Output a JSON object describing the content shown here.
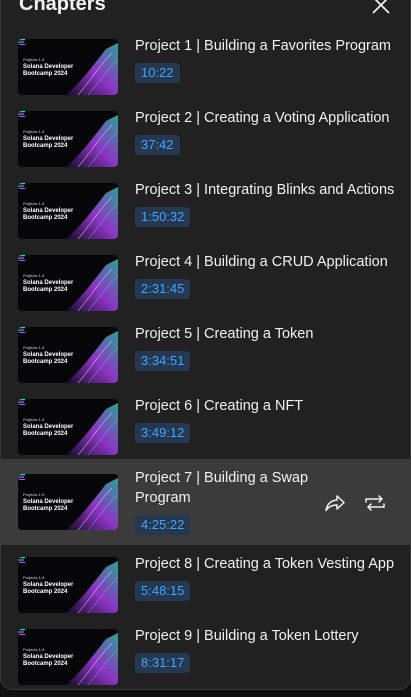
{
  "header": {
    "title": "Chapters"
  },
  "chapters": [
    {
      "title": "Project 1 | Building a Favorites Program",
      "time": "10:22",
      "thumb_sub": "Projects 1-9",
      "thumb_title": "Solana Developer Bootcamp 2024"
    },
    {
      "title": "Project 2 | Creating a Voting Application",
      "time": "37:42",
      "thumb_sub": "Projects 1-9",
      "thumb_title": "Solana Developer Bootcamp 2024"
    },
    {
      "title": "Project 3 | Integrating Blinks and Actions",
      "time": "1:50:32",
      "thumb_sub": "Projects 1-9",
      "thumb_title": "Solana Developer Bootcamp 2024"
    },
    {
      "title": "Project 4 | Building a CRUD Application",
      "time": "2:31:45",
      "thumb_sub": "Projects 1-9",
      "thumb_title": "Solana Developer Bootcamp 2024"
    },
    {
      "title": "Project 5 | Creating a Token",
      "time": "3:34:51",
      "thumb_sub": "Projects 1-9",
      "thumb_title": "Solana Developer Bootcamp 2024"
    },
    {
      "title": "Project 6 | Creating a NFT",
      "time": "3:49:12",
      "thumb_sub": "Projects 1-9",
      "thumb_title": "Solana Developer Bootcamp 2024"
    },
    {
      "title": "Project 7 | Building a Swap Program",
      "time": "4:25:22",
      "thumb_sub": "Projects 1-9",
      "thumb_title": "Solana Developer Bootcamp 2024",
      "active": true
    },
    {
      "title": "Project 8 | Creating a Token Vesting App",
      "time": "5:48:15",
      "thumb_sub": "Projects 1-9",
      "thumb_title": "Solana Developer Bootcamp 2024"
    },
    {
      "title": "Project 9 | Building a Token Lottery",
      "time": "8:31:17",
      "thumb_sub": "Projects 1-9",
      "thumb_title": "Solana Developer Bootcamp 2024"
    }
  ],
  "icons": {
    "close": "close-icon",
    "share": "share-icon",
    "loop": "repeat-icon",
    "logo": "solana-logo-icon"
  },
  "colors": {
    "panel_bg": "#212121",
    "active_bg": "#3b3b3b",
    "time_badge_bg": "#263850",
    "time_badge_text": "#3ea6ff"
  }
}
